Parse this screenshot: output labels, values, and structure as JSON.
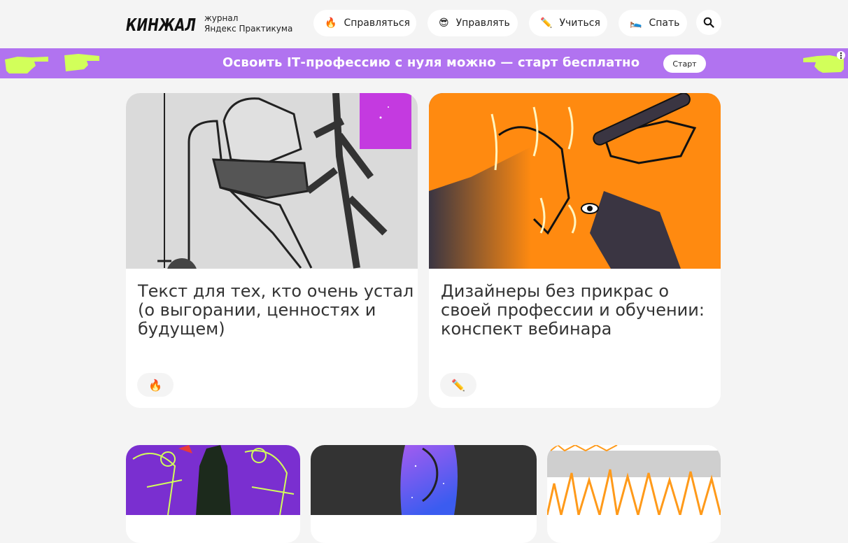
{
  "header": {
    "logo_text": "КИНЖАЛ",
    "logo_sub_line1": "журнал",
    "logo_sub_line2": "Яндекс Практикума",
    "nav": [
      {
        "emoji": "🔥",
        "label": "Справляться"
      },
      {
        "emoji": "😎",
        "label": "Управлять"
      },
      {
        "emoji": "✏️",
        "label": "Учиться"
      },
      {
        "emoji": "🛌",
        "label": "Спать"
      }
    ],
    "search_icon": "search-icon"
  },
  "banner": {
    "text": "Освоить IT‑профессию с нуля можно — старт бесплатно",
    "button_label": "Старт",
    "bg_color": "#b173f0",
    "hand_color": "#d2ff5a"
  },
  "cards": [
    {
      "title": "Текст для тех, кто очень устал (о выгорании, ценностях и будущем)",
      "tag_emoji": "🔥"
    },
    {
      "title": "Дизайнеры без прикрас о своей профессии и обучении: конспект вебинара",
      "tag_emoji": "✏️"
    }
  ]
}
